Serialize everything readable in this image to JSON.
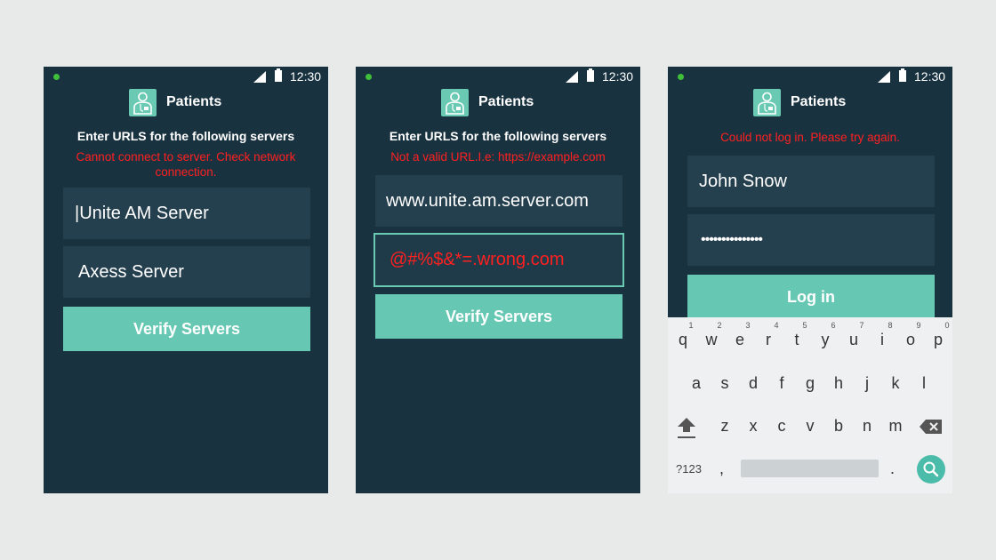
{
  "status_bar": {
    "time": "12:30"
  },
  "app": {
    "title": "Patients"
  },
  "screen1": {
    "instruction": "Enter URLS for the following servers",
    "error_line1": "Cannot connect to server. Check network",
    "error_line2": "connection.",
    "field_unite": "|Unite AM Server",
    "field_axess": "Axess Server",
    "verify_label": "Verify Servers"
  },
  "screen2": {
    "instruction": "Enter URLS for the following servers",
    "error": "Not a valid URL.I.e: https://example.com",
    "field_unite": "www.unite.am.server.com",
    "field_axess": "@#%$&*=.wrong.com",
    "verify_label": "Verify Servers"
  },
  "screen3": {
    "error": "Could not log in. Please try again.",
    "username": "John Snow",
    "password": "•••••••••••••••",
    "login_label": "Log in"
  },
  "keyboard": {
    "row1": [
      "q",
      "w",
      "e",
      "r",
      "t",
      "y",
      "u",
      "i",
      "o",
      "p"
    ],
    "row1_hints": [
      "1",
      "2",
      "3",
      "4",
      "5",
      "6",
      "7",
      "8",
      "9",
      "0"
    ],
    "row2": [
      "a",
      "s",
      "d",
      "f",
      "g",
      "h",
      "j",
      "k",
      "l"
    ],
    "row3": [
      "z",
      "x",
      "c",
      "v",
      "b",
      "n",
      "m"
    ],
    "symbols_label": "?123",
    "comma": ",",
    "period": ".",
    "icons": [
      "shift-icon",
      "backspace-icon",
      "search-icon"
    ]
  },
  "colors": {
    "background": "#e8eae9",
    "screen": "#193240",
    "field": "#243f4e",
    "accent": "#66c7b3",
    "error": "#ff2020"
  }
}
